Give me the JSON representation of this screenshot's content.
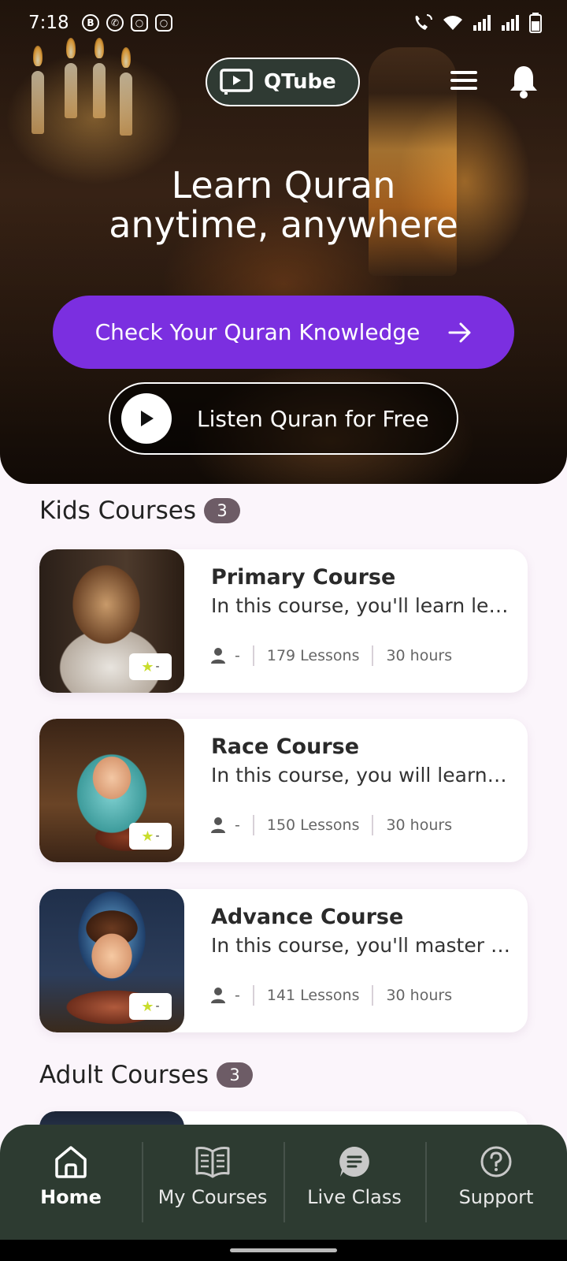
{
  "status_bar": {
    "time": "7:18",
    "app_icons": [
      "b-icon",
      "whatsapp-icon",
      "instagram-icon",
      "instagram-icon"
    ]
  },
  "header": {
    "logo_text": "QTube"
  },
  "hero": {
    "title_line1": "Learn Quran",
    "title_line2": "anytime, anywhere",
    "primary_cta": "Check Your Quran Knowledge",
    "secondary_cta": "Listen Quran for Free"
  },
  "kids": {
    "title": "Kids Courses",
    "count": "3",
    "courses": [
      {
        "title": "Primary Course",
        "description": "In this course, you'll learn letters and pronunciation",
        "instructor": "-",
        "lessons": "179 Lessons",
        "duration": "30 hours",
        "rating": "-"
      },
      {
        "title": "Race Course",
        "description": "In this course, you will learn to read fluently",
        "instructor": "-",
        "lessons": "150 Lessons",
        "duration": "30 hours",
        "rating": "-"
      },
      {
        "title": "Advance Course",
        "description": "In this course, you'll master the rules of Tajweed",
        "instructor": "-",
        "lessons": "141 Lessons",
        "duration": "30 hours",
        "rating": "-"
      }
    ]
  },
  "adult": {
    "title": "Adult Courses",
    "count": "3"
  },
  "nav": {
    "items": [
      {
        "label": "Home",
        "icon": "home-icon"
      },
      {
        "label": "My Courses",
        "icon": "book-icon"
      },
      {
        "label": "Live Class",
        "icon": "chat-icon"
      },
      {
        "label": "Support",
        "icon": "help-icon"
      }
    ]
  },
  "colors": {
    "primary": "#7b2fe0",
    "nav_bg": "#2d3b31",
    "badge": "#6d5c66",
    "star": "#c9dd2c"
  }
}
